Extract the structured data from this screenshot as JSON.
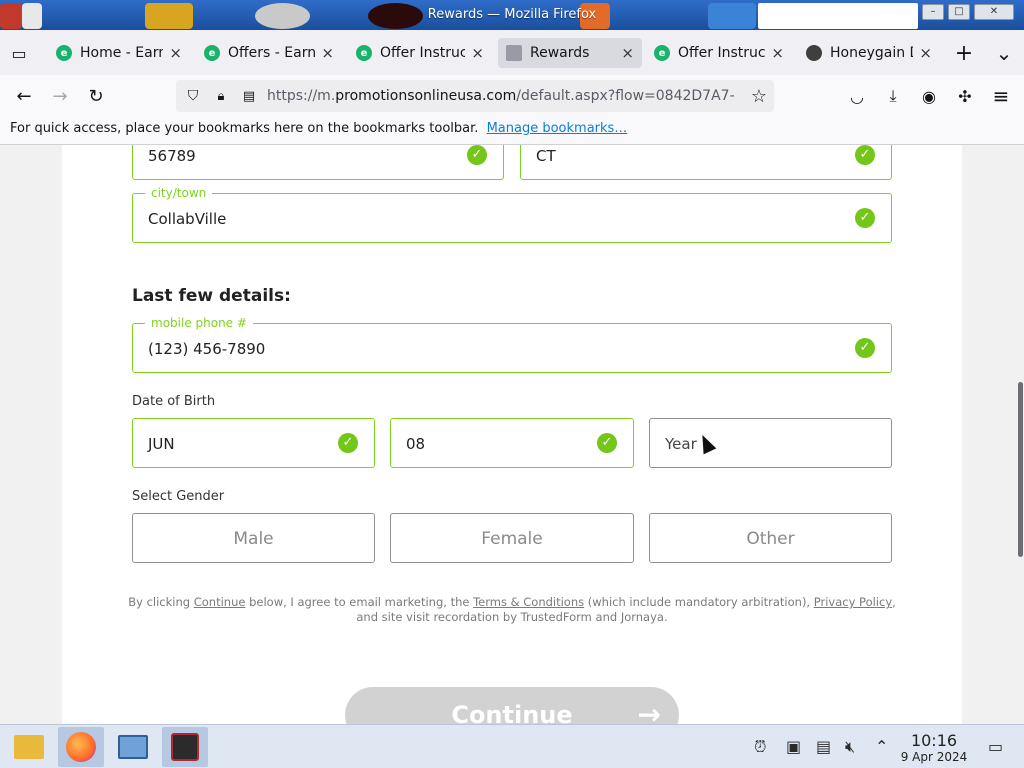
{
  "window": {
    "title": "Rewards — Mozilla Firefox",
    "controls": [
      "minimize",
      "maximize",
      "close"
    ]
  },
  "tabs": [
    {
      "label": "Home - EarnG",
      "favicon": "earngg-icon",
      "active": false
    },
    {
      "label": "Offers - EarnG",
      "favicon": "earngg-icon",
      "active": false
    },
    {
      "label": "Offer Instructi",
      "favicon": "earngg-icon",
      "active": false
    },
    {
      "label": "Rewards",
      "favicon": "page-icon",
      "active": true
    },
    {
      "label": "Offer Instructi",
      "favicon": "earngg-icon",
      "active": false
    },
    {
      "label": "Honeygain Da",
      "favicon": "honeygain-icon",
      "active": false
    }
  ],
  "tab_close_glyph": "×",
  "new_tab_glyph": "+",
  "list_tabs_glyph": "⌄",
  "nav": {
    "url_prefix": "https://m.",
    "url_host": "promotionsonlineusa.com",
    "url_path": "/default.aspx?flow=0842D7A7-",
    "back_glyph": "←",
    "forward_glyph": "→",
    "reload_glyph": "↻",
    "star_glyph": "☆",
    "menu_glyph": "≡"
  },
  "bookmarks": {
    "message": "For quick access, place your bookmarks here on the bookmarks toolbar.",
    "link": "Manage bookmarks…"
  },
  "form": {
    "zip_value": "56789",
    "state_value": "CT",
    "city_label": "city/town",
    "city_value": "CollabVille",
    "section_title": "Last few details:",
    "phone_label": "mobile phone #",
    "phone_value": "(123) 456-7890",
    "dob_label": "Date of Birth",
    "dob_month": "JUN",
    "dob_day": "08",
    "dob_year_placeholder": "Year",
    "gender_label": "Select Gender",
    "gender_options": [
      "Male",
      "Female",
      "Other"
    ],
    "check_glyph": "✓",
    "legal": {
      "p1": "By clicking ",
      "continue_link": "Continue",
      "p2": " below, I agree to email marketing, the ",
      "terms_link": "Terms & Conditions",
      "p3": " (which include mandatory arbitration), ",
      "privacy_link": "Privacy Policy",
      "p4": ", and site visit recordation by TrustedForm and Jornaya."
    },
    "continue_label": "Continue",
    "continue_arrow": "→"
  },
  "taskbar": {
    "apps": [
      "file-manager-icon",
      "firefox-icon",
      "system-monitor-icon",
      "terminal-icon"
    ],
    "tray": [
      "alarm-icon",
      "clipboard-icon",
      "notes-icon",
      "mute-icon",
      "chevron-up-icon",
      "desktop-icon"
    ],
    "time": "10:16",
    "date": "9 Apr 2024"
  },
  "colors": {
    "valid_green": "#7ed321",
    "check_green": "#74c61a",
    "button_disabled": "#d2d2d2",
    "link_blue": "#0b7fd4"
  }
}
